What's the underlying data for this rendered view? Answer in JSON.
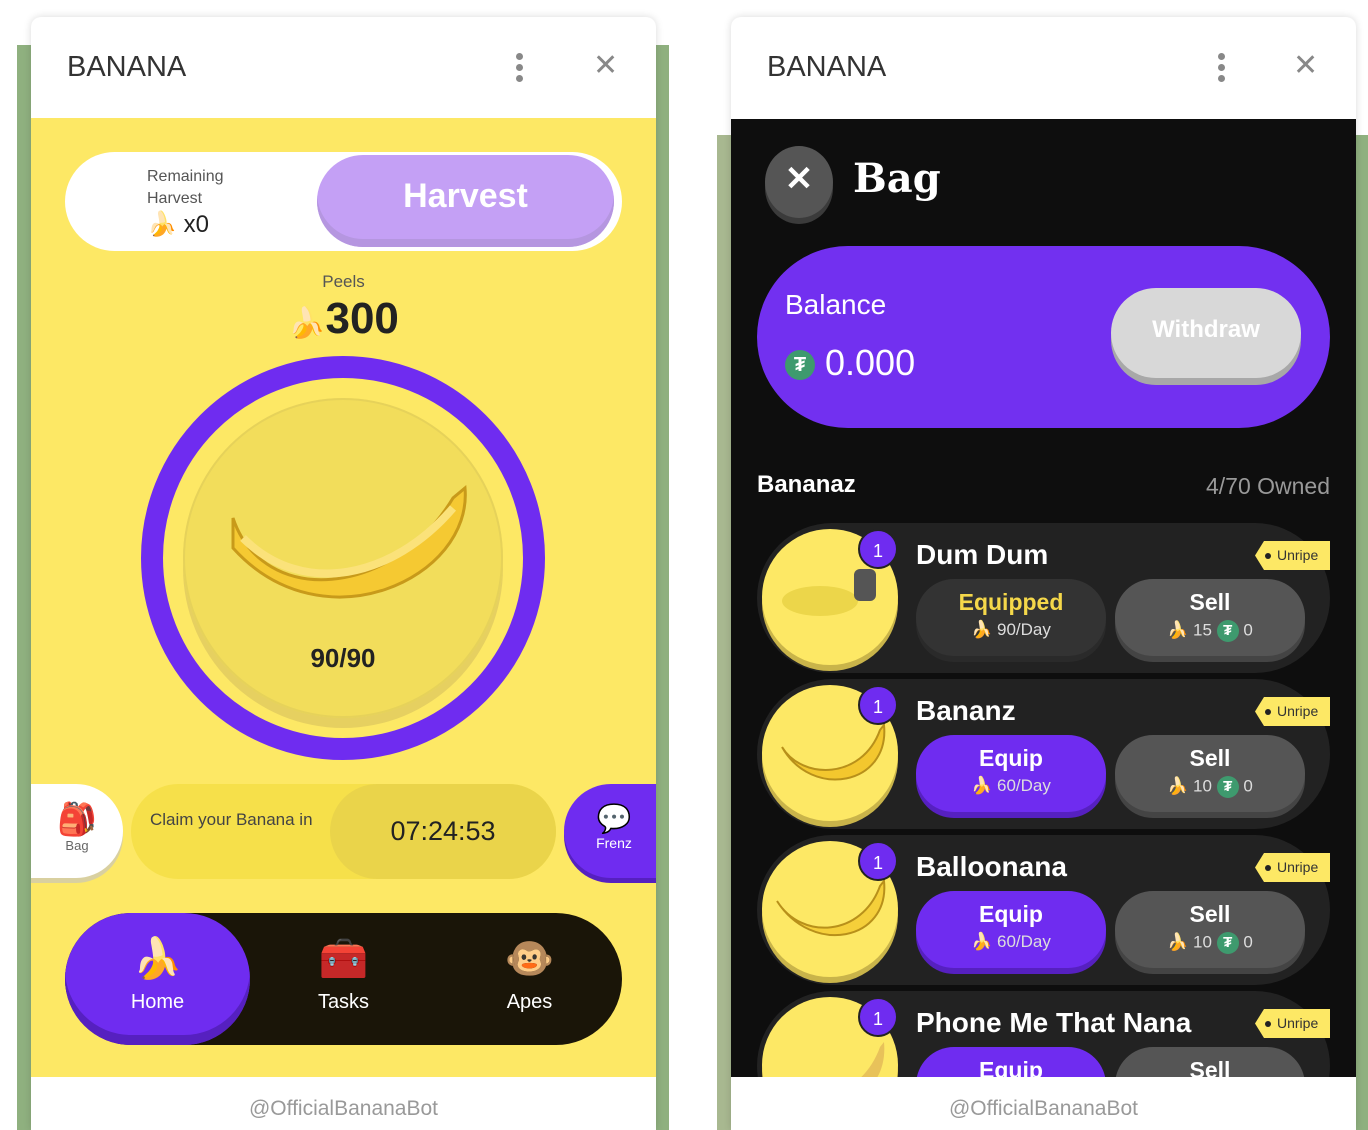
{
  "left": {
    "title": "BANANA",
    "harvest": {
      "remaining_label": "Remaining Harvest",
      "count": "x0",
      "button": "Harvest"
    },
    "peels": {
      "label": "Peels",
      "value": "300"
    },
    "progress": {
      "text": "90/90",
      "fraction": 1.0
    },
    "bag_label": "Bag",
    "claim": {
      "text": "Claim your Banana in",
      "timer": "07:24:53"
    },
    "frenz_label": "Frenz",
    "nav": [
      {
        "label": "Home",
        "icon": "banana-icon",
        "active": true
      },
      {
        "label": "Tasks",
        "icon": "treasure-chest-icon"
      },
      {
        "label": "Apes",
        "icon": "monkeys-icon"
      }
    ],
    "footer": "@OfficialBananaBot"
  },
  "right": {
    "title": "BANANA",
    "page_title": "Bag",
    "balance": {
      "label": "Balance",
      "value": "0.000",
      "button": "Withdraw"
    },
    "section": {
      "title": "Bananaz",
      "owned": "4/70 Owned"
    },
    "items": [
      {
        "name": "Dum Dum",
        "count": "1",
        "tag": "Unripe",
        "action": "Equipped",
        "rate": "90/Day",
        "sell": "Sell",
        "sell_peels": "15",
        "sell_usdt": "0",
        "equipped": true
      },
      {
        "name": "Bananz",
        "count": "1",
        "tag": "Unripe",
        "action": "Equip",
        "rate": "60/Day",
        "sell": "Sell",
        "sell_peels": "10",
        "sell_usdt": "0"
      },
      {
        "name": "Balloonana",
        "count": "1",
        "tag": "Unripe",
        "action": "Equip",
        "rate": "60/Day",
        "sell": "Sell",
        "sell_peels": "10",
        "sell_usdt": "0"
      },
      {
        "name": "Phone Me That Nana",
        "count": "1",
        "tag": "Unripe",
        "action": "Equip",
        "sell": "Sell"
      }
    ],
    "footer": "@OfficialBananaBot"
  },
  "colors": {
    "purple": "#6f2cf0",
    "yellow": "#fde865",
    "dark": "#111111",
    "usdt": "#3e9a6e"
  }
}
